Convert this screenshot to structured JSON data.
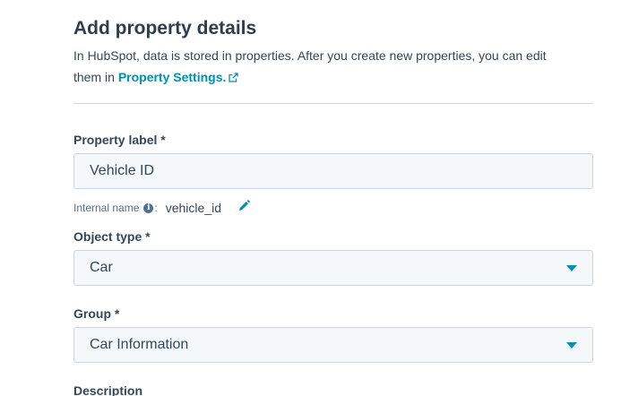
{
  "header": {
    "title": "Add property details",
    "intro_line1": "In HubSpot, data is stored in properties. After you create new properties, you can edit",
    "intro_line2_prefix": "them in ",
    "settings_link": "Property Settings."
  },
  "form": {
    "property_label": {
      "label": "Property label *",
      "value": "Vehicle ID"
    },
    "internal_name": {
      "label": "Internal name",
      "colon": ":",
      "value": "vehicle_id"
    },
    "object_type": {
      "label": "Object type *",
      "value": "Car"
    },
    "group": {
      "label": "Group *",
      "value": "Car Information"
    },
    "description": {
      "label": "Description"
    }
  },
  "icons": {
    "external_link": "external-link-icon",
    "info": "info-icon",
    "edit": "pencil-icon",
    "dropdown": "chevron-down-icon"
  },
  "colors": {
    "accent": "#0091ae",
    "text": "#33475b",
    "heading": "#2d3e50",
    "field_bg": "#f5f8fa",
    "field_border": "#cbd6e2"
  }
}
